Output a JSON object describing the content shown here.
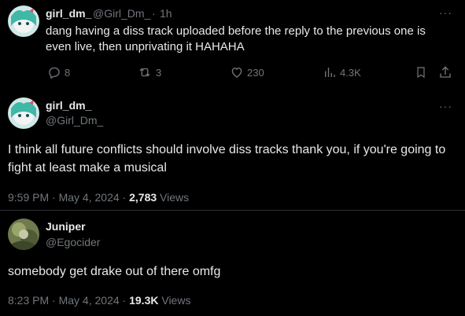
{
  "tweet1": {
    "display_name": "girl_dm_",
    "handle": "@Girl_Dm_",
    "dot": "·",
    "time": "1h",
    "more": "···",
    "text": "dang having a diss track uploaded before the reply to the previous one is even live, then unprivating it HAHAHA",
    "actions": {
      "replies": "8",
      "reposts": "3",
      "likes": "230",
      "views": "4.3K"
    }
  },
  "tweet2": {
    "display_name": "girl_dm_",
    "handle": "@Girl_Dm_",
    "more": "···",
    "text": "I think all future conflicts should involve diss tracks thank you, if you're going to fight at least make a musical",
    "time": "9:59 PM",
    "date": "May 4, 2024",
    "dot": "·",
    "views_count": "2,783",
    "views_label": "Views"
  },
  "tweet3": {
    "display_name": "Juniper",
    "handle": "@Egocider",
    "text": "somebody get drake out of there omfg",
    "time": "8:23 PM",
    "date": "May 4, 2024",
    "dot": "·",
    "views_count": "19.3K",
    "views_label": "Views"
  },
  "colors": {
    "background": "#000000",
    "text": "#e7e9ea",
    "muted": "#71767b",
    "divider": "#2f3336"
  },
  "icons": [
    "reply-icon",
    "repost-icon",
    "like-icon",
    "views-icon",
    "bookmark-icon",
    "share-icon",
    "more-icon"
  ]
}
